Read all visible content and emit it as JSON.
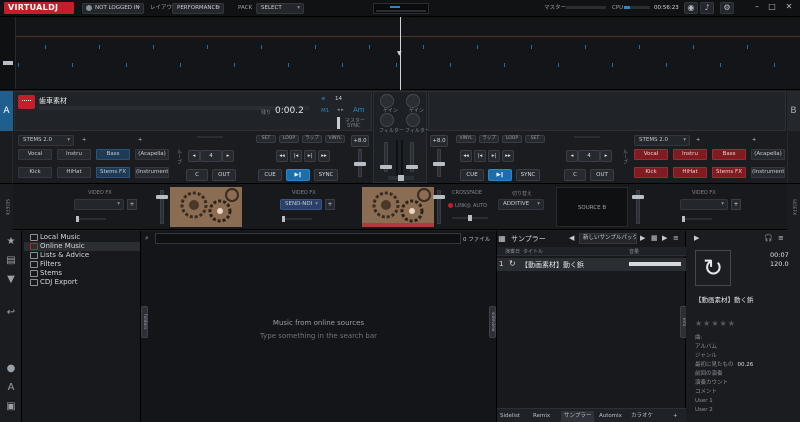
{
  "topbar": {
    "logo": "VIRTUALDJ",
    "login": "NOT LOGGED IN",
    "layout_label": "レイアウト",
    "layout_value": "PERFORMANCE",
    "pack_label": "PACK",
    "pack_value": "SELECT",
    "master_label": "マスター",
    "cpu_label": "CPU",
    "clock": "00:56:23"
  },
  "deck_left": {
    "letter": "A",
    "title": "歯車素材",
    "remain_label": "残り",
    "time": "0:00.2",
    "bpm_prefix": "14",
    "key_mode": "M1",
    "key": "Am",
    "master_label": "マスター",
    "sync_label": "SYNC",
    "stems_select": "STEMS 2.0",
    "pads_row1": [
      "Vocal",
      "Instru",
      "Bass",
      "(Acapella)"
    ],
    "pads_row2": [
      "Kick",
      "HiHat",
      "Stems FX",
      "(Instrumental)"
    ],
    "loop_value": "4",
    "cue": "CUE",
    "play": "▶‖",
    "sync": "SYNC",
    "c_label": "C",
    "out_label": "OUT",
    "fx_labels": [
      "SET",
      "LOOP",
      "ラップ",
      "VINYL"
    ],
    "pitch": "+8.0"
  },
  "deck_right": {
    "letter": "B",
    "stems_select": "STEMS 2.0",
    "pads_row1": [
      "Vocal",
      "Instru",
      "Bass",
      "(Acapella)"
    ],
    "pads_row2": [
      "Kick",
      "HiHat",
      "Stems FX",
      "(Instrumental)"
    ],
    "loop_value": "4",
    "cue": "CUE",
    "play": "▶‖",
    "sync": "SYNC",
    "c_label": "C",
    "out_label": "OUT",
    "fx_labels": [
      "VINYL",
      "ラップ",
      "LOOP",
      "SET"
    ],
    "pitch": "+8.0"
  },
  "mixer": {
    "gain_label": "ゲイン",
    "filter_label": "フィルター"
  },
  "fx": {
    "side_left": "SIDEFX",
    "side_right": "SIDEFX",
    "video_fx_left": "VIDEO FX",
    "video_fx_center": "VIDEO FX",
    "video_fx_right": "VIDEO FX",
    "send_ndi": "SEND-NDI",
    "crossfade_label": "CROSSFADE",
    "link": "LINK",
    "auto": "AUTO",
    "switch_label": "切り替え",
    "switch_value": "ADDITIVE",
    "source": "SOURCE B"
  },
  "browser": {
    "tree": [
      {
        "label": "Local Music",
        "selected": false
      },
      {
        "label": "Online Music",
        "selected": true
      },
      {
        "label": "Lists & Advice",
        "selected": false
      },
      {
        "label": "Filters",
        "selected": false
      },
      {
        "label": "Stems",
        "selected": false
      },
      {
        "label": "CDJ Export",
        "selected": false
      }
    ],
    "search_placeholder": "",
    "file_count": "0 ファイル",
    "empty_title": "Music from online sources",
    "empty_hint": "Type something in the search bar",
    "folders_handle": "folders",
    "sideview_handle": "sideview",
    "info_handle": "info"
  },
  "sampler": {
    "title": "サンプラー",
    "pack": "新しいサンプルパック",
    "col_trigger": "演奏日",
    "col_title": "タイトル",
    "col_volume": "音量",
    "row_index": "1",
    "row_title": "【動画素材】動く鋲",
    "tabs": [
      "Sidelist",
      "Remix",
      "サンプラー",
      "Automix",
      "カラオケ"
    ]
  },
  "info": {
    "time1": "00:07",
    "time2": "120.0",
    "title": "【動画素材】動く鋲",
    "rows": [
      {
        "label": "曲:",
        "value": ""
      },
      {
        "label": "アルバム",
        "value": ""
      },
      {
        "label": "ジャンル",
        "value": ""
      },
      {
        "label": "最初に見たもの",
        "value": "00.26"
      },
      {
        "label": "前回の演奏",
        "value": ""
      },
      {
        "label": "演奏カウント",
        "value": ""
      },
      {
        "label": "コメント",
        "value": ""
      },
      {
        "label": "User 1",
        "value": ""
      },
      {
        "label": "User 2",
        "value": ""
      }
    ]
  },
  "colors": {
    "accent": "#1d6ea8",
    "brand": "#c31e2a",
    "stem_red": "#7e1c22"
  }
}
